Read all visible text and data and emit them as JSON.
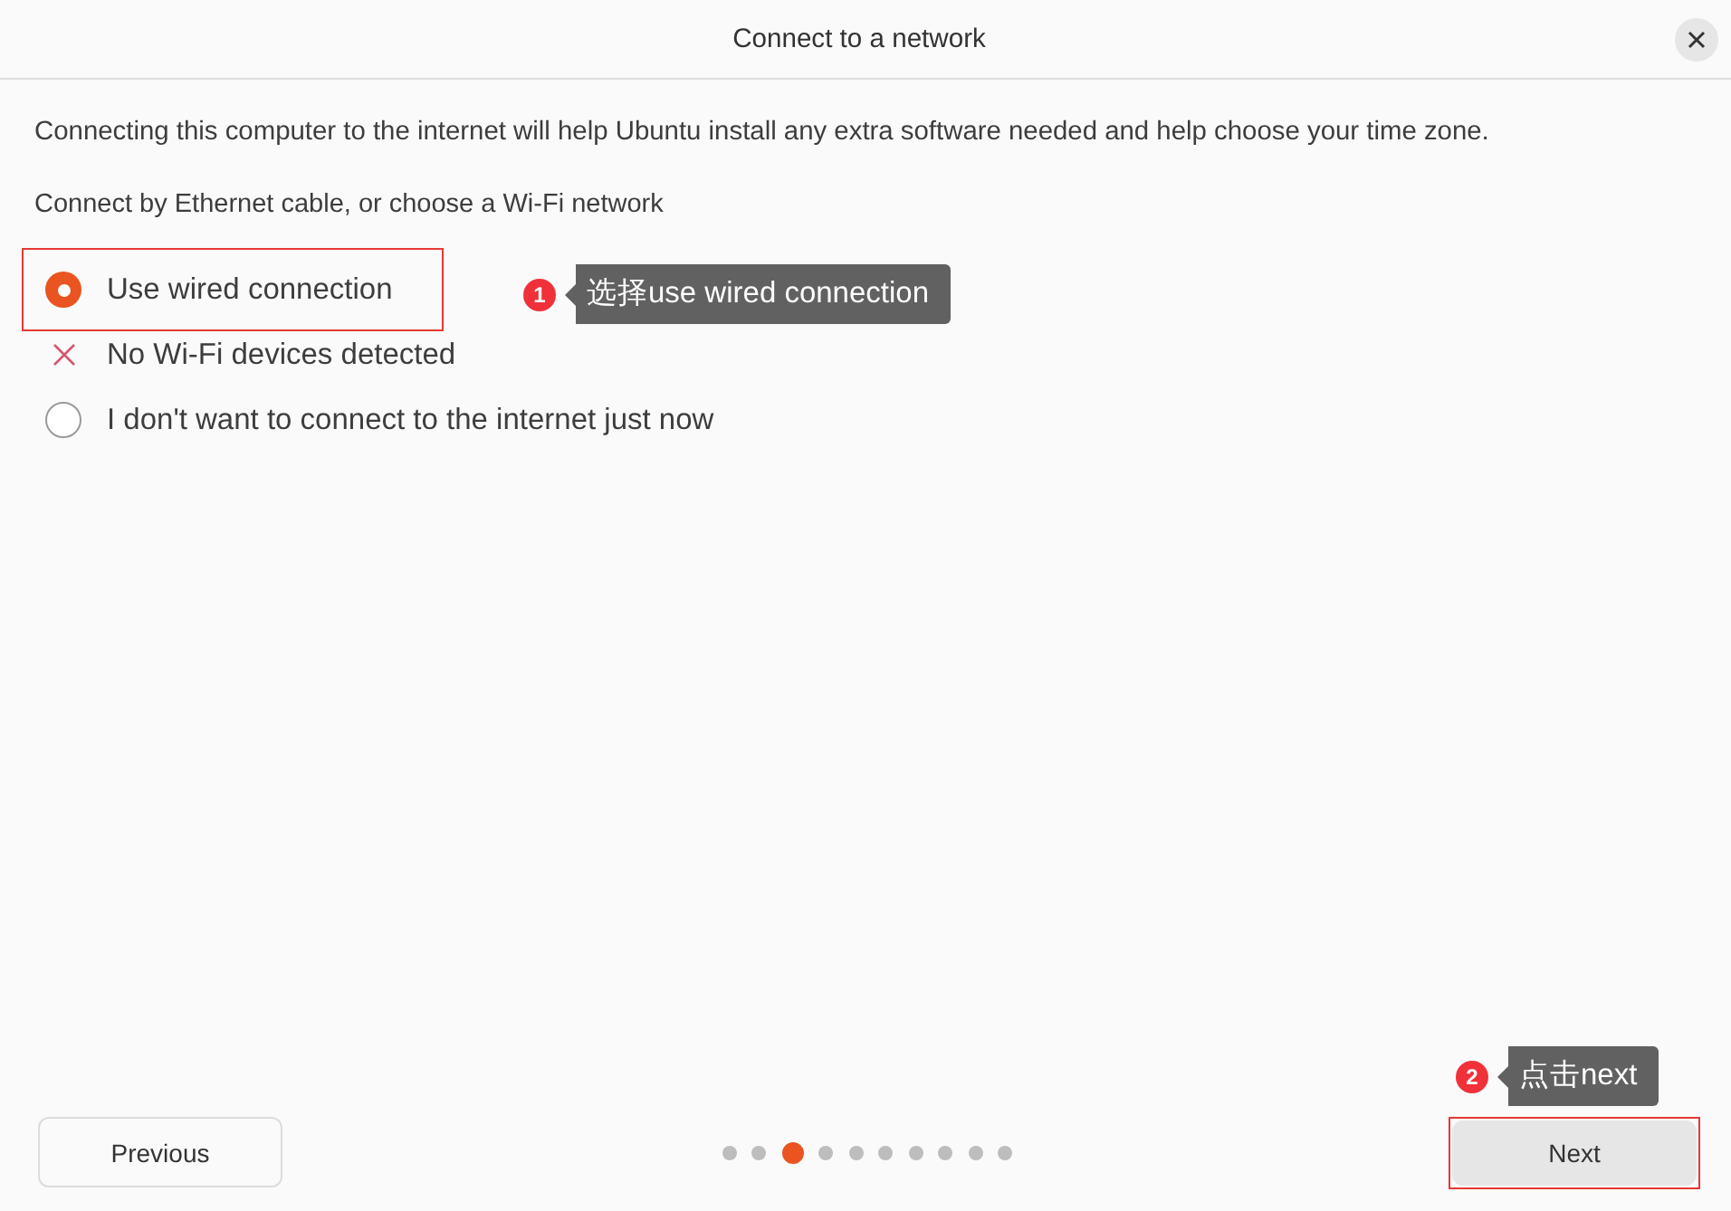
{
  "window": {
    "title": "Connect to a network"
  },
  "intro": "Connecting this computer to the internet will help Ubuntu install any extra software needed and help choose your time zone.",
  "prompt": "Connect by Ethernet cable, or choose a Wi-Fi network",
  "options": [
    {
      "kind": "radio",
      "label": "Use wired connection",
      "selected": true,
      "highlighted": true
    },
    {
      "kind": "status",
      "label": "No Wi-Fi devices detected"
    },
    {
      "kind": "radio",
      "label": "I don't want to connect to the internet just now",
      "selected": false,
      "highlighted": false
    }
  ],
  "annotations": [
    {
      "number": "1",
      "text": "选择use wired connection"
    },
    {
      "number": "2",
      "text": "点击next"
    }
  ],
  "pager": {
    "steps": [
      {
        "selected": false
      },
      {
        "selected": false
      },
      {
        "selected": true
      },
      {
        "selected": false
      },
      {
        "selected": false
      },
      {
        "selected": false
      },
      {
        "selected": false
      },
      {
        "selected": false
      },
      {
        "selected": false
      },
      {
        "selected": false
      }
    ]
  },
  "buttons": [
    {
      "label": "Previous",
      "kind": "outlined",
      "highlighted": false
    },
    {
      "label": "Next",
      "kind": "filled",
      "highlighted": true
    }
  ]
}
